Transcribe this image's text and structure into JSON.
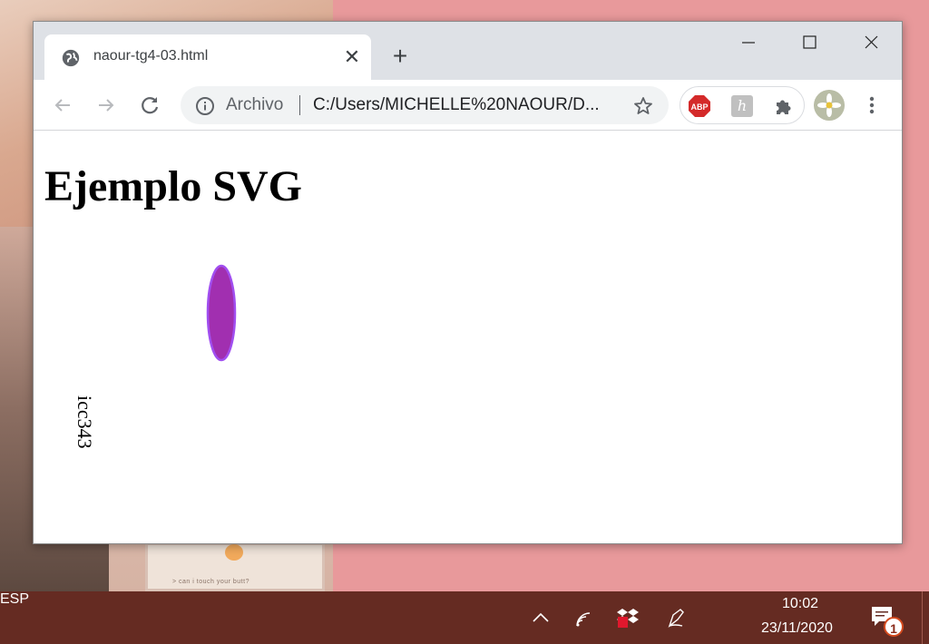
{
  "browser": {
    "tab_title": "naour-tg4-03.html",
    "tab_close": "✕",
    "new_tab": "+",
    "omnibox_label": "Archivo",
    "url": "C:/Users/MICHELLE%20NAOUR/D...",
    "ext_h_label": "h"
  },
  "page": {
    "heading": "Ejemplo SVG",
    "svg": {
      "ellipse_fill": "#a12fb0",
      "ellipse_stroke": "#a14ff0",
      "rotated_text": "icc343"
    }
  },
  "taskbar": {
    "language": "ESP",
    "time": "10:02",
    "date": "23/11/2020",
    "notification_count": "1"
  },
  "wallpaper": {
    "caption": "> can i touch your butt?"
  }
}
